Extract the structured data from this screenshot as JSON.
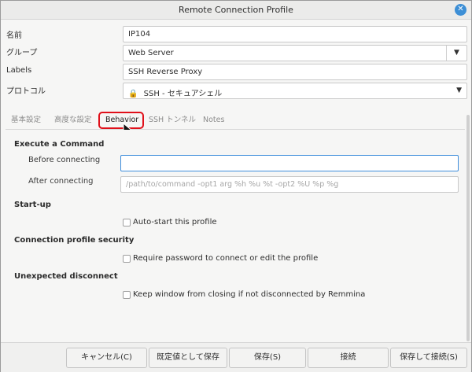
{
  "window": {
    "title": "Remote Connection Profile",
    "close_icon": "close-icon"
  },
  "form": {
    "name_label": "名前",
    "name_value": "IP104",
    "group_label": "グループ",
    "group_value": "Web Server",
    "labels_label": "Labels",
    "labels_value": "SSH Reverse Proxy",
    "protocol_label": "プロトコル",
    "protocol_value": "SSH - セキュアシェル"
  },
  "tabs": [
    {
      "label": "基本設定",
      "active": false
    },
    {
      "label": "高度な設定",
      "active": false
    },
    {
      "label": "Behavior",
      "active": true
    },
    {
      "label": "SSH トンネル",
      "active": false
    },
    {
      "label": "Notes",
      "active": false
    }
  ],
  "behavior": {
    "execute_title": "Execute a Command",
    "before_label": "Before connecting",
    "before_value": "",
    "after_label": "After connecting",
    "after_placeholder": "/path/to/command -opt1 arg %h %u %t -opt2 %U %p %g",
    "startup_title": "Start-up",
    "autostart_label": "Auto-start this profile",
    "autostart_checked": false,
    "security_title": "Connection profile security",
    "require_password_label": "Require password to connect or edit the profile",
    "require_password_checked": false,
    "disconnect_title": "Unexpected disconnect",
    "keep_window_label": "Keep window from closing if not disconnected by Remmina",
    "keep_window_checked": false
  },
  "buttons": {
    "cancel": "キャンセル(C)",
    "save_default": "既定値として保存",
    "save": "保存(S)",
    "connect": "接続",
    "save_connect": "保存して接続(S)"
  },
  "colors": {
    "highlight": "#e0101a",
    "focus_border": "#3f8edb",
    "close_button": "#3d8fd6"
  }
}
